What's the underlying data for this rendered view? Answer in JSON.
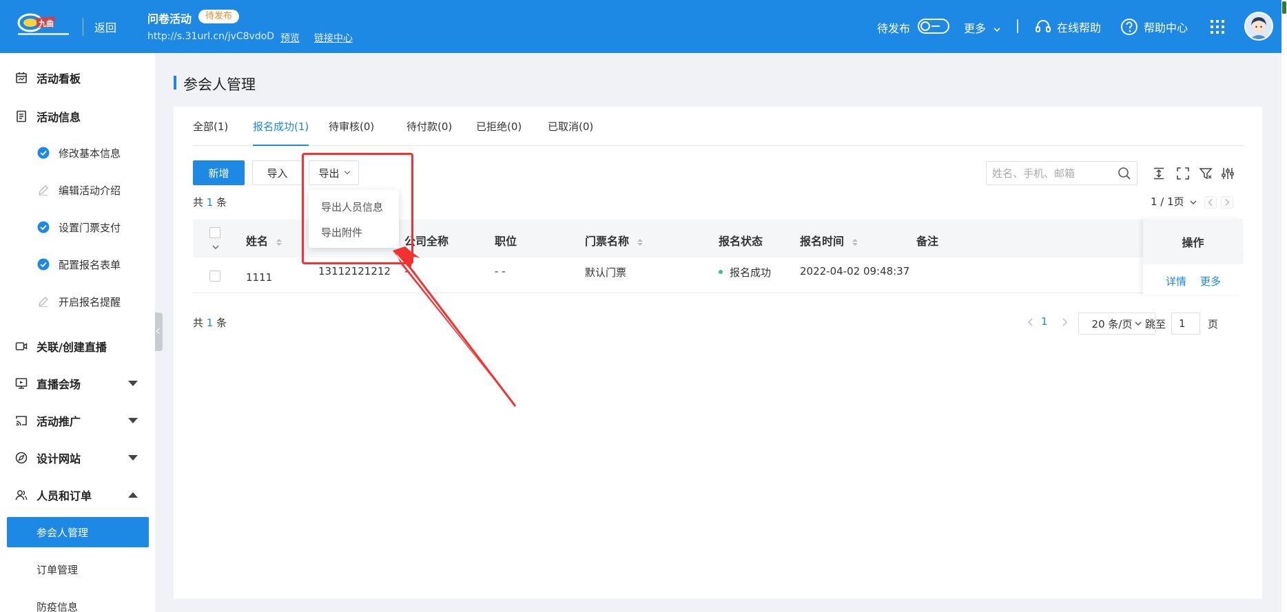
{
  "header": {
    "back_label": "返回",
    "survey_title": "问卷活动",
    "status": "待发布",
    "short_url": "http://s.31url.cn/jvC8vdoD",
    "preview_label": "预览",
    "link_center_label": "链接中心",
    "publish_label": "待发布",
    "more_label": "更多",
    "online_help_label": "在线帮助",
    "help_center_label": "帮助中心",
    "accent_color": "#1e88e5"
  },
  "sidebar": {
    "items": [
      {
        "label": "活动看板",
        "icon": "calendar-icon"
      },
      {
        "label": "活动信息",
        "icon": "document-icon"
      },
      {
        "label": "修改基本信息",
        "icon": "check-circle-icon"
      },
      {
        "label": "编辑活动介绍",
        "icon": "pencil-icon"
      },
      {
        "label": "设置门票支付",
        "icon": "check-circle-icon"
      },
      {
        "label": "配置报名表单",
        "icon": "check-circle-icon"
      },
      {
        "label": "开启报名提醒",
        "icon": "pencil-icon"
      },
      {
        "label": "关联/创建直播",
        "icon": "video-icon"
      },
      {
        "label": "直播会场",
        "icon": "broadcast-icon"
      },
      {
        "label": "活动推广",
        "icon": "cast-icon"
      },
      {
        "label": "设计网站",
        "icon": "compass-icon"
      },
      {
        "label": "人员和订单",
        "icon": "users-icon"
      },
      {
        "label": "参会人管理",
        "icon": ""
      },
      {
        "label": "订单管理",
        "icon": ""
      },
      {
        "label": "防疫信息",
        "icon": ""
      }
    ]
  },
  "page": {
    "title": "参会人管理"
  },
  "tabs": [
    {
      "label": "全部(1)"
    },
    {
      "label": "报名成功(1)"
    },
    {
      "label": "待审核(0)"
    },
    {
      "label": "待付款(0)"
    },
    {
      "label": "已拒绝(0)"
    },
    {
      "label": "已取消(0)"
    }
  ],
  "toolbar": {
    "add_label": "新增",
    "import_label": "导入",
    "export_label": "导出",
    "search_placeholder": "姓名、手机、邮箱"
  },
  "export_menu": {
    "items": [
      "导出人员信息",
      "导出附件"
    ]
  },
  "summary": {
    "prefix": "共",
    "count": "1",
    "suffix": "条"
  },
  "pager_top": {
    "label": "1 / 1页"
  },
  "table": {
    "columns": [
      "姓名",
      "公司全称",
      "职位",
      "门票名称",
      "报名状态",
      "报名时间",
      "备注",
      "操作"
    ],
    "rows": [
      {
        "name": "1111",
        "phone": "13112121212",
        "company": "- -",
        "position": "- -",
        "ticket": "默认门票",
        "status": "报名成功",
        "time": "2022-04-02 09:48:37",
        "remark": "",
        "detail_label": "详情",
        "more_label": "更多"
      }
    ]
  },
  "pagination": {
    "current": "1",
    "page_size": "20 条/页",
    "jump_label": "跳至",
    "jump_value": "1",
    "page_suffix": "页"
  }
}
